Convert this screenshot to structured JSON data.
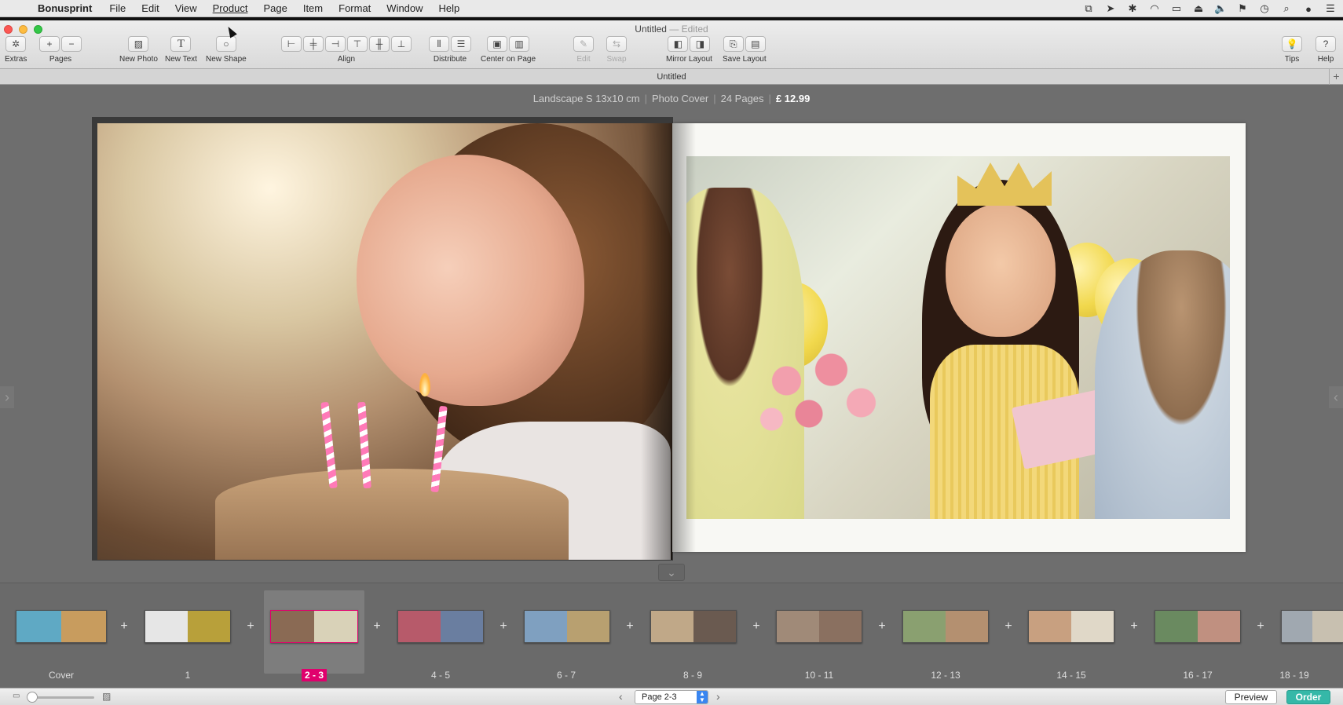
{
  "menubar": {
    "app": "Bonusprint",
    "items": [
      "File",
      "Edit",
      "View",
      "Product",
      "Page",
      "Item",
      "Format",
      "Window",
      "Help"
    ],
    "active": "Product"
  },
  "window": {
    "title": "Untitled",
    "edited": "— Edited"
  },
  "toolbar": {
    "extras": "Extras",
    "pages": "Pages",
    "new_photo": "New Photo",
    "new_text": "New Text",
    "new_shape": "New Shape",
    "align": "Align",
    "distribute": "Distribute",
    "center_on_page": "Center on Page",
    "edit": "Edit",
    "swap": "Swap",
    "mirror_layout": "Mirror Layout",
    "save_layout": "Save Layout",
    "tips": "Tips",
    "help": "Help"
  },
  "doc_tab": {
    "title": "Untitled"
  },
  "product": {
    "format": "Landscape S 13x10 cm",
    "cover": "Photo Cover",
    "pages": "24 Pages",
    "price": "£ 12.99"
  },
  "thumbnails": [
    {
      "label": "Cover",
      "colors": [
        "#5fa9c4",
        "#c89c5e"
      ]
    },
    {
      "label": "1",
      "colors": [
        "#e6e6e6",
        "#b8a03a"
      ]
    },
    {
      "label": "2 - 3",
      "colors": [
        "#8a6a54",
        "#d9d2b8"
      ],
      "selected": true
    },
    {
      "label": "4 - 5",
      "colors": [
        "#b75a6a",
        "#6a7ea0"
      ]
    },
    {
      "label": "6 - 7",
      "colors": [
        "#7fa0c0",
        "#b8a070"
      ]
    },
    {
      "label": "8 - 9",
      "colors": [
        "#c0a888",
        "#6a5a50"
      ]
    },
    {
      "label": "10 - 11",
      "colors": [
        "#a08a78",
        "#8a7060"
      ]
    },
    {
      "label": "12 - 13",
      "colors": [
        "#8aa070",
        "#b49070"
      ]
    },
    {
      "label": "14 - 15",
      "colors": [
        "#c8a080",
        "#e0d8c8"
      ]
    },
    {
      "label": "16 - 17",
      "colors": [
        "#6a8a60",
        "#c09080"
      ]
    },
    {
      "label": "18 - 19",
      "colors": [
        "#a0a8b0",
        "#c8c0b0"
      ]
    }
  ],
  "bottom": {
    "page_select": "Page 2-3",
    "preview": "Preview",
    "order": "Order"
  },
  "colors": {
    "order_button": "#35b8a8",
    "selected_label": "#e0006d"
  }
}
